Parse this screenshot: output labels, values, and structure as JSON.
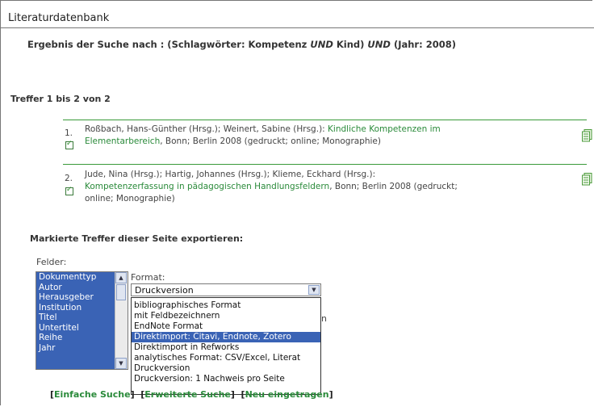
{
  "header": {
    "title": "Literaturdatenbank"
  },
  "query": {
    "prefix": "Ergebnis der Suche nach : (Schlagwörter: Kompetenz ",
    "op1": "UND",
    "mid": " Kind) ",
    "op2": "UND",
    "suffix": " (Jahr: 2008)"
  },
  "results": {
    "summary": "Treffer 1 bis 2 von 2",
    "items": [
      {
        "num": "1.",
        "authors": "Roßbach, Hans-Günther (Hrsg.); Weinert, Sabine (Hrsg.): ",
        "title_line1": "Kindliche Kompetenzen im",
        "title_line2": "Elementarbereich",
        "rest": ", Bonn; Berlin 2008 (gedruckt; online; Monographie)"
      },
      {
        "num": "2.",
        "authors": "Jude, Nina (Hrsg.); Hartig, Johannes (Hrsg.); Klieme, Eckhard (Hrsg.):",
        "title": "Kompetenzerfassung in pädagogischen Handlungsfeldern",
        "rest1": ", Bonn; Berlin 2008 (gedruckt;",
        "rest2": "online; Monographie)"
      }
    ]
  },
  "export": {
    "heading": "Markierte Treffer dieser Seite exportieren:",
    "fields_label": "Felder:",
    "fields": [
      "Dokumenttyp",
      "Autor",
      "Herausgeber",
      "Institution",
      "Titel",
      "Untertitel",
      "Reihe",
      "Jahr"
    ],
    "format_label": "Format:",
    "format_selected": "Druckversion",
    "format_options": [
      "bibliographisches Format",
      "mit Feldbezeichnern",
      "EndNote Format",
      "Direktimport: Citavi, Endnote, Zotero",
      "Direktimport in Refworks",
      "analytisches Format: CSV/Excel, Literat",
      "Druckversion",
      "Druckversion: 1 Nachweis pro Seite"
    ],
    "highlighted_option_index": 3,
    "partially_hidden_text": "n"
  },
  "footer_links": {
    "simple": "Einfache Suche",
    "advanced": "Erweiterte Suche",
    "new": "Neu eingetragen"
  },
  "colors": {
    "link_green": "#2a8a3a",
    "select_blue": "#3a63b5"
  }
}
